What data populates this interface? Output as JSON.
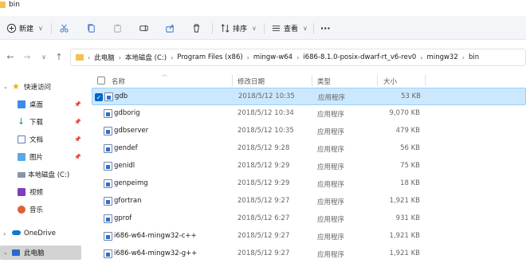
{
  "window": {
    "title": "bin"
  },
  "toolbar": {
    "new_label": "新建",
    "sort_label": "排序",
    "view_label": "查看",
    "more_label": "···"
  },
  "nav": {
    "back": "←",
    "forward": "→",
    "chev": "∨",
    "up": "↑"
  },
  "breadcrumb": [
    "此电脑",
    "本地磁盘 (C:)",
    "Program Files (x86)",
    "mingw-w64",
    "i686-8.1.0-posix-dwarf-rt_v6-rev0",
    "mingw32",
    "bin"
  ],
  "sidebar": {
    "items": [
      {
        "label": "快速访问",
        "pinned": false
      },
      {
        "label": "桌面",
        "pinned": true
      },
      {
        "label": "下载",
        "pinned": true
      },
      {
        "label": "文档",
        "pinned": true
      },
      {
        "label": "图片",
        "pinned": true
      },
      {
        "label": "本地磁盘 (C:)",
        "pinned": false
      },
      {
        "label": "视频",
        "pinned": false
      },
      {
        "label": "音乐",
        "pinned": false
      },
      {
        "label": "OneDrive",
        "pinned": false
      },
      {
        "label": "此电脑",
        "pinned": false
      }
    ]
  },
  "columns": {
    "name": "名称",
    "modified": "修改日期",
    "type": "类型",
    "size": "大小"
  },
  "files": [
    {
      "name": "gdb",
      "modified": "2018/5/12 10:35",
      "type": "应用程序",
      "size": "53 KB"
    },
    {
      "name": "gdborig",
      "modified": "2018/5/12 10:34",
      "type": "应用程序",
      "size": "9,070 KB"
    },
    {
      "name": "gdbserver",
      "modified": "2018/5/12 10:35",
      "type": "应用程序",
      "size": "479 KB"
    },
    {
      "name": "gendef",
      "modified": "2018/5/12 9:28",
      "type": "应用程序",
      "size": "56 KB"
    },
    {
      "name": "genidl",
      "modified": "2018/5/12 9:29",
      "type": "应用程序",
      "size": "75 KB"
    },
    {
      "name": "genpeimg",
      "modified": "2018/5/12 9:29",
      "type": "应用程序",
      "size": "18 KB"
    },
    {
      "name": "gfortran",
      "modified": "2018/5/12 9:27",
      "type": "应用程序",
      "size": "1,921 KB"
    },
    {
      "name": "gprof",
      "modified": "2018/5/12 6:27",
      "type": "应用程序",
      "size": "931 KB"
    },
    {
      "name": "i686-w64-mingw32-c++",
      "modified": "2018/5/12 9:27",
      "type": "应用程序",
      "size": "1,921 KB"
    },
    {
      "name": "i686-w64-mingw32-g++",
      "modified": "2018/5/12 9:27",
      "type": "应用程序",
      "size": "1,921 KB"
    }
  ],
  "colors": {
    "accent": "#0067c0",
    "selection": "#cce8ff",
    "folder": "#f2c14e"
  }
}
